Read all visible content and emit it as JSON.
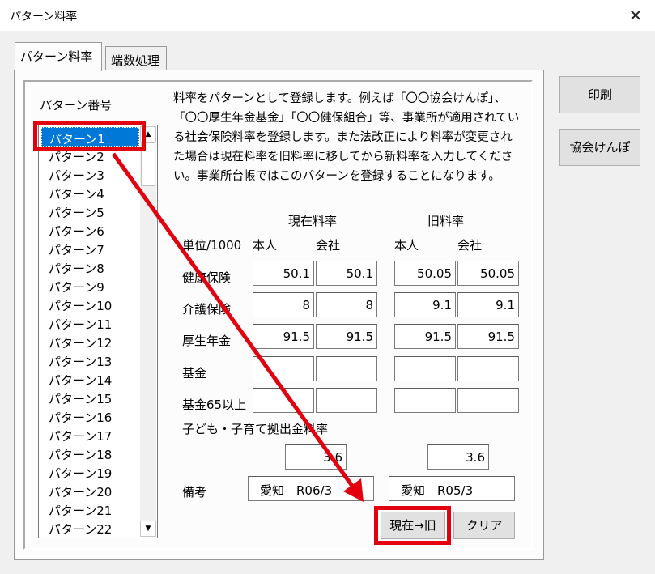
{
  "window": {
    "title": "パターン料率",
    "close_glyph": "✕"
  },
  "tabs": [
    "パターン料率",
    "端数処理"
  ],
  "list": {
    "label": "パターン番号",
    "items": [
      "パターン1",
      "パターン2",
      "パターン3",
      "パターン4",
      "パターン5",
      "パターン6",
      "パターン7",
      "パターン8",
      "パターン9",
      "パターン10",
      "パターン11",
      "パターン12",
      "パターン13",
      "パターン14",
      "パターン15",
      "パターン16",
      "パターン17",
      "パターン18",
      "パターン19",
      "パターン20",
      "パターン21",
      "パターン22"
    ]
  },
  "description": "料率をパターンとして登録します。例えば「〇〇協会けんぽ」、「〇〇厚生年金基金」「〇〇健保組合」等、事業所が適用されている社会保険料率を登録します。また法改正により料率が変更された場合は現在料率を旧料率に移してから新料率を入力してください。事業所台帳ではこのパターンを登録することになります。",
  "rates": {
    "current_header": "現在料率",
    "old_header": "旧料率",
    "unit": "単位/1000",
    "self": "本人",
    "company": "会社",
    "rows": [
      {
        "label": "健康保険",
        "values": [
          "50.1",
          "50.1",
          "50.05",
          "50.05"
        ]
      },
      {
        "label": "介護保険",
        "values": [
          "8",
          "8",
          "9.1",
          "9.1"
        ]
      },
      {
        "label": "厚生年金",
        "values": [
          "91.5",
          "91.5",
          "91.5",
          "91.5"
        ]
      },
      {
        "label": "基金",
        "values": [
          "",
          "",
          "",
          ""
        ]
      },
      {
        "label": "基金65以上",
        "values": [
          "",
          "",
          "",
          ""
        ]
      }
    ],
    "child_label": "子ども・子育て拠出金料率",
    "child_current": "3.6",
    "child_old": "3.6",
    "remarks_label": "備考",
    "remarks_current": "愛知　R06/3",
    "remarks_old": "愛知　R05/3"
  },
  "buttons": {
    "print": "印刷",
    "kyokai": "協会けんぽ",
    "move": "現在→旧",
    "clear": "クリア"
  },
  "colors": {
    "highlight": "#e2000e",
    "selection": "#0078d7"
  }
}
